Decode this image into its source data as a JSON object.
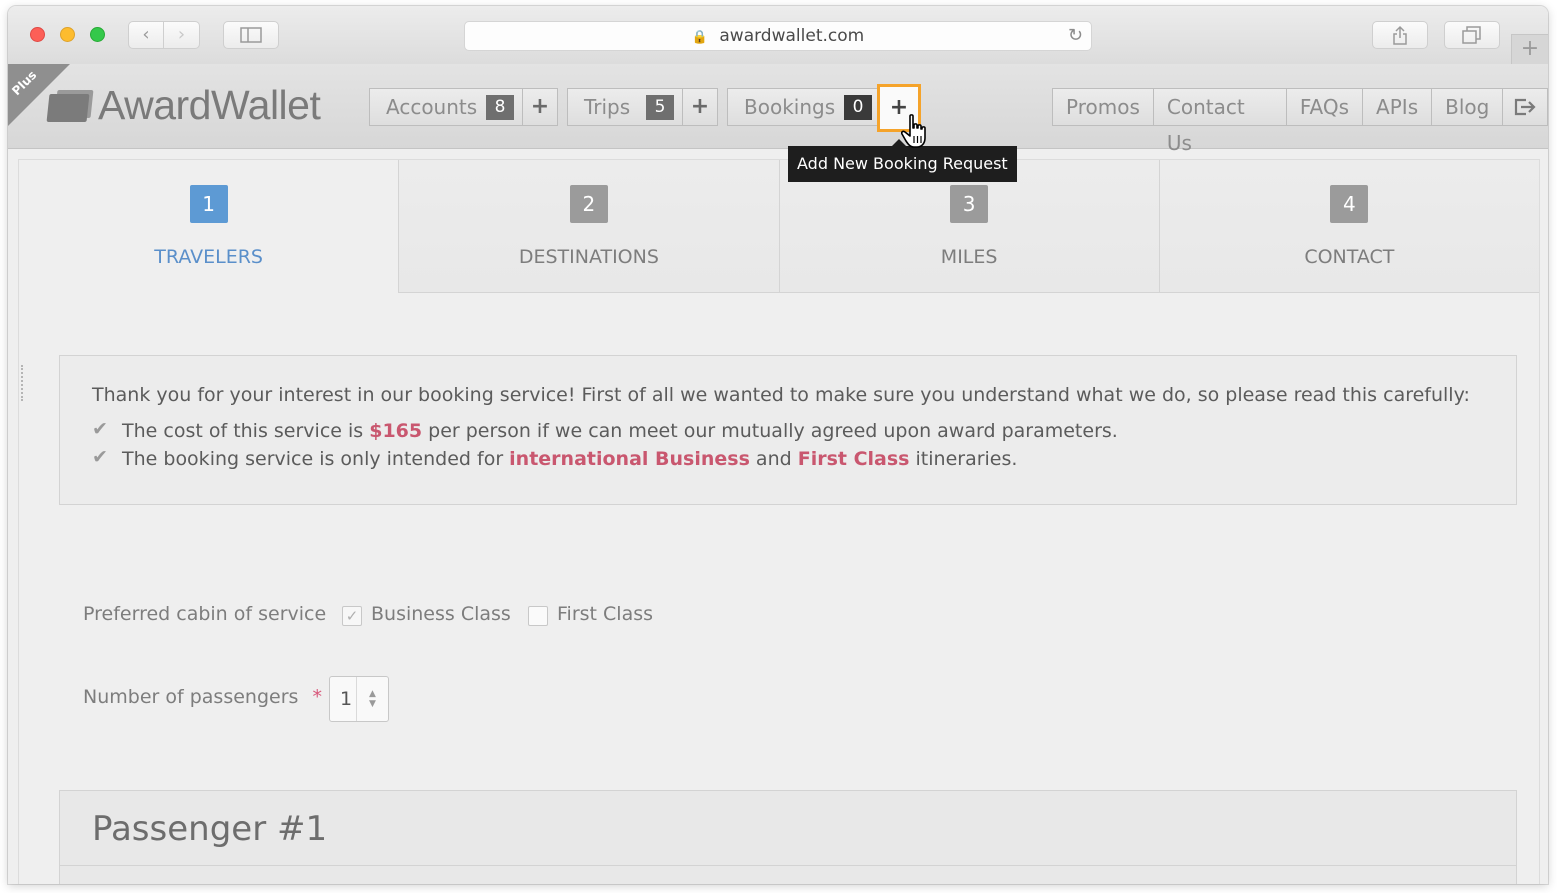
{
  "browser": {
    "url": "awardwallet.com",
    "back_icon": "‹",
    "forward_icon": "›",
    "new_tab_icon": "+"
  },
  "header": {
    "ribbon": "Plus",
    "brand": "AwardWallet",
    "nav": [
      {
        "label": "Accounts",
        "count": "8",
        "count_color": "#6f6f6f"
      },
      {
        "label": "Trips",
        "count": "5",
        "count_color": "#6f6f6f"
      },
      {
        "label": "Bookings",
        "count": "0",
        "count_color": "#3a3a3a"
      }
    ],
    "plus": "+",
    "right_nav": [
      "Promos",
      "Contact Us",
      "FAQs",
      "APIs",
      "Blog"
    ],
    "tooltip": "Add New Booking Request",
    "active_color": "#f5a32a"
  },
  "steps": [
    {
      "num": "1",
      "name": "TRAVELERS",
      "active": true
    },
    {
      "num": "2",
      "name": "DESTINATIONS"
    },
    {
      "num": "3",
      "name": "MILES"
    },
    {
      "num": "4",
      "name": "CONTACT"
    }
  ],
  "notice": {
    "intro": "Thank you for your interest in our booking service! First of all we wanted to make sure you understand what we do, so please read this carefully:",
    "line1_pre": "The cost of this service is ",
    "line1_price": "$165",
    "line1_post": " per person if we can meet our mutually agreed upon award parameters.",
    "line2_pre": "The booking service is only intended for ",
    "line2_hl1": "international Business",
    "line2_mid": " and ",
    "line2_hl2": "First Class",
    "line2_post": " itineraries.",
    "highlight_color": "#c9576f"
  },
  "form": {
    "cabin_label": "Preferred cabin of service",
    "cabin_options": [
      {
        "label": "Business Class",
        "checked": true
      },
      {
        "label": "First Class",
        "checked": false
      }
    ],
    "passengers_label": "Number of passengers",
    "required_mark": "*",
    "passengers_value": "1"
  },
  "passenger_panel": {
    "title": "Passenger #1"
  }
}
